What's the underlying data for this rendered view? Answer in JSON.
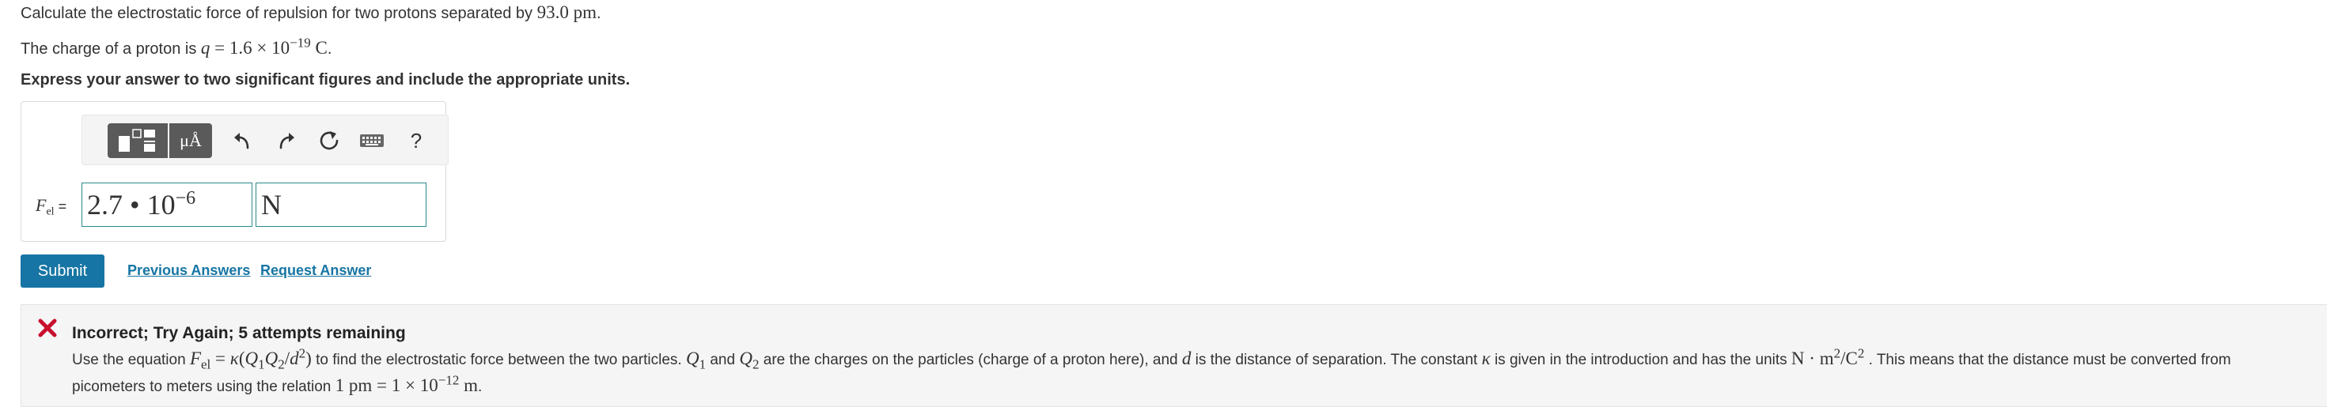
{
  "question": {
    "line1_text": "Calculate the electrostatic force of repulsion for two protons separated by ",
    "line1_value": "93.0 pm",
    "line1_end": ".",
    "line2_text": "The charge of a proton is ",
    "line2_var": "q",
    "line2_eq": " = 1.6 × 10",
    "line2_exp": "−19",
    "line2_unit": " C",
    "line2_end": ".",
    "instruction": "Express your answer to two significant figures and include the appropriate units."
  },
  "toolbar": {
    "units_label": "μÅ",
    "help_label": "?"
  },
  "answer": {
    "label_var": "F",
    "label_sub": "el",
    "label_eq": " =",
    "value_mantissa": "2.7 • 10",
    "value_exponent": "−6",
    "unit_value": "N"
  },
  "actions": {
    "submit_label": "Submit",
    "previous_answers_label": "Previous Answers",
    "request_answer_label": "Request Answer"
  },
  "feedback": {
    "title": "Incorrect; Try Again; 5 attempts remaining",
    "t1": "Use the equation ",
    "eq_F": "F",
    "eq_Fsub": "el",
    "eq_rest_a": " = ",
    "eq_kappa": "κ",
    "eq_rest_b": "(",
    "eq_Q1": "Q",
    "eq_Q1sub": "1",
    "eq_Q2": "Q",
    "eq_Q2sub": "2",
    "eq_slash": "/",
    "eq_d": "d",
    "eq_dsup": "2",
    "eq_close": ")",
    "t2": " to find the electrostatic force between the two particles. ",
    "q1": "Q",
    "q1sub": "1",
    "t3": " and ",
    "q2": "Q",
    "q2sub": "2",
    "t4": " are the charges on the particles (charge of a proton here), and ",
    "d": "d",
    "t5": " is the distance of separation. The constant ",
    "kappa": "κ",
    "t6": " is given in the introduction and has the units ",
    "units_a": "N · m",
    "units_sup1": "2",
    "units_b": "/C",
    "units_sup2": "2",
    "t7": " . This means that the distance must be converted from",
    "t8": "picometers to meters using the relation ",
    "rel_a": "1 pm = 1 × 10",
    "rel_exp": "−12",
    "rel_b": " m",
    "t9": "."
  },
  "colors": {
    "accent": "#1675a4",
    "input_border": "#2a8a8c",
    "error": "#c8102e"
  },
  "icons": [
    "templates-icon",
    "units-icon",
    "undo-icon",
    "redo-icon",
    "reset-icon",
    "keyboard-icon",
    "help-icon",
    "x-icon"
  ]
}
